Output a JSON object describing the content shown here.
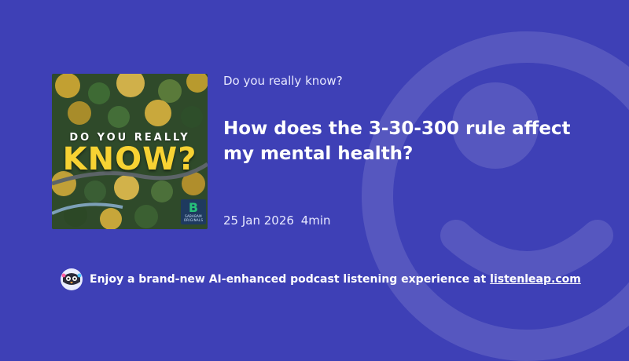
{
  "colors": {
    "background": "#3e40b6",
    "cover_title": "#f7d233",
    "badge_bg": "#1e3a5f",
    "badge_logo": "#27c07a"
  },
  "cover": {
    "top_text": "DO YOU REALLY",
    "main_text": "KNOW?",
    "badge_logo": "B",
    "badge_label": "SABABAM ORIGINALS"
  },
  "podcast": {
    "show_name": "Do you really know?",
    "episode_title": "How does the 3-30-300 rule affect my mental health?",
    "date": "25 Jan 2026",
    "duration": "4min"
  },
  "promo": {
    "text": "Enjoy a brand-new AI-enhanced podcast listening experience at",
    "link_text": "listenleap.com",
    "icon": "penguin-mascot-icon"
  }
}
